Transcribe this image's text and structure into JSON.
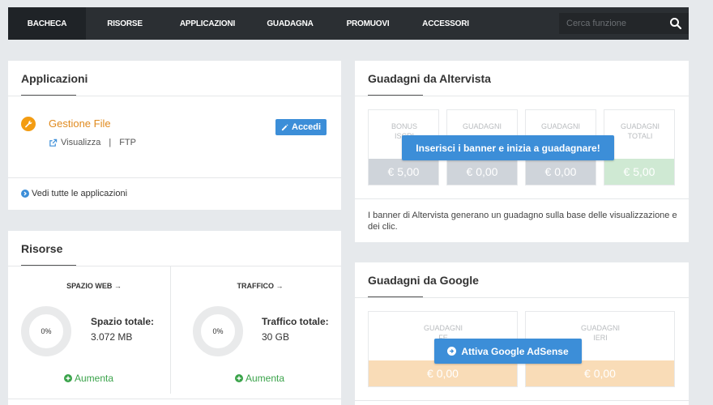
{
  "nav": {
    "items": [
      "BACHECA",
      "RISORSE",
      "APPLICAZIONI",
      "GUADAGNA",
      "PROMUOVI",
      "ACCESSORI"
    ],
    "search_placeholder": "Cerca funzione",
    "search_icon": "search-icon"
  },
  "applicazioni": {
    "title": "Applicazioni",
    "app_name": "Gestione File",
    "link_visualizza": "Visualizza",
    "separator": "|",
    "link_ftp": "FTP",
    "accedi_label": "Accedi",
    "vedi_tutte": "Vedi tutte le applicazioni"
  },
  "risorse": {
    "title": "Risorse",
    "spazio": {
      "head": "SPAZIO WEB →",
      "percent": "0%",
      "label": "Spazio totale:",
      "value": "3.072 MB",
      "aumenta": "Aumenta"
    },
    "traffico": {
      "head": "TRAFFICO →",
      "percent": "0%",
      "label": "Traffico totale:",
      "value": "30 GB",
      "aumenta": "Aumenta"
    }
  },
  "altervista": {
    "title": "Guadagni da Altervista",
    "boxes": [
      {
        "label": "BONUS ISCRI",
        "value": "€ 5,00"
      },
      {
        "label": "GUADAGNI",
        "value": "€ 0,00"
      },
      {
        "label": "GUADAGNI",
        "value": "€ 0,00"
      },
      {
        "label": "GUADAGNI TOTALI",
        "value": "€ 5,00"
      }
    ],
    "banner_button": "Inserisci i banner e inizia a guadagnare!",
    "note": "I banner di Altervista generano un guadagno sulla base delle visualizzazione e dei clic."
  },
  "google": {
    "title": "Guadagni da Google",
    "boxes": [
      {
        "label": "GUADAGNI FE",
        "value": "€ 0,00"
      },
      {
        "label": "GUADAGNI IERI",
        "value": "€ 0,00"
      }
    ],
    "adsense_button": "Attiva Google AdSense"
  },
  "colors": {
    "accent": "#3c8ed8",
    "orange": "#f39c12",
    "green": "#3aa34a",
    "nav_bg": "#2b2f33"
  }
}
